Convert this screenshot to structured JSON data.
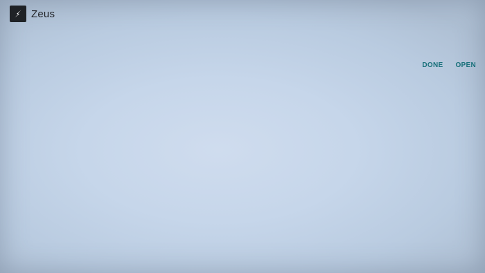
{
  "app": {
    "title": "Zeus",
    "icon": "lightning-bolt-icon"
  },
  "actions": {
    "done_label": "DONE",
    "open_label": "OPEN"
  },
  "colors": {
    "background": "#c6d6ea",
    "icon_bg": "#1f2226",
    "accent": "#18707a"
  }
}
